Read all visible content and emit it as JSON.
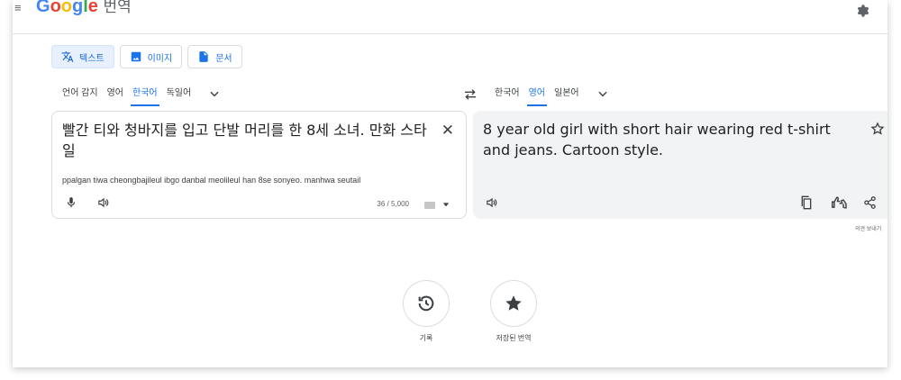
{
  "app": {
    "logo_word": "Google",
    "logo_suffix": "번역",
    "brand_colors": [
      "#4285f4",
      "#ea4335",
      "#fbbc05",
      "#4285f4",
      "#34a853",
      "#ea4335"
    ]
  },
  "modes": [
    {
      "label": "텍스트",
      "icon": "translate-icon",
      "active": true
    },
    {
      "label": "이미지",
      "icon": "image-icon",
      "active": false
    },
    {
      "label": "문서",
      "icon": "document-icon",
      "active": false
    }
  ],
  "source_langs": {
    "tabs": [
      "언어 감지",
      "영어",
      "한국어",
      "독일어"
    ],
    "active": "한국어"
  },
  "target_langs": {
    "tabs": [
      "한국어",
      "영어",
      "일본어"
    ],
    "active": "영어"
  },
  "source": {
    "text": "빨간 티와 청바지를 입고 단발 머리를 한 8세 소녀. 만화 스타일",
    "romanization": "ppalgan tiwa cheongbajileul ibgo danbal meolileul han 8se sonyeo. manhwa seutail",
    "char_count": "36 / 5,000"
  },
  "target": {
    "text": "8 year old girl with short hair wearing red t-shirt and jeans. Cartoon style."
  },
  "feedback_label": "의견 보내기",
  "bottom": {
    "history_label": "기록",
    "saved_label": "저장된 번역"
  },
  "colors": {
    "accent": "#1a73e8",
    "active_mode_bg": "#e8f0fe",
    "target_panel_bg": "#f1f3f4"
  }
}
